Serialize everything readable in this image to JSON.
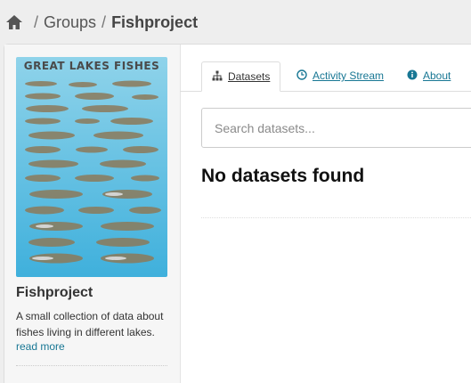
{
  "breadcrumb": {
    "home_icon": "home-icon",
    "separator": "/",
    "groups": "Groups",
    "current": "Fishproject"
  },
  "sidebar": {
    "poster": {
      "title_text": "GREAT LAKES FISHES",
      "background_color": "#5cbfe0"
    },
    "title": "Fishproject",
    "description": "A small collection of data about fishes living in different lakes.",
    "read_more": "read more"
  },
  "tabs": [
    {
      "label": "Datasets",
      "icon": "sitemap-icon",
      "active": true
    },
    {
      "label": "Activity Stream",
      "icon": "clock-icon",
      "active": false
    },
    {
      "label": "About",
      "icon": "info-icon",
      "active": false
    }
  ],
  "search": {
    "value": "",
    "placeholder": "Search datasets..."
  },
  "results": {
    "empty_message": "No datasets found"
  },
  "colors": {
    "link": "#187794",
    "page_background": "#eeeeee"
  }
}
